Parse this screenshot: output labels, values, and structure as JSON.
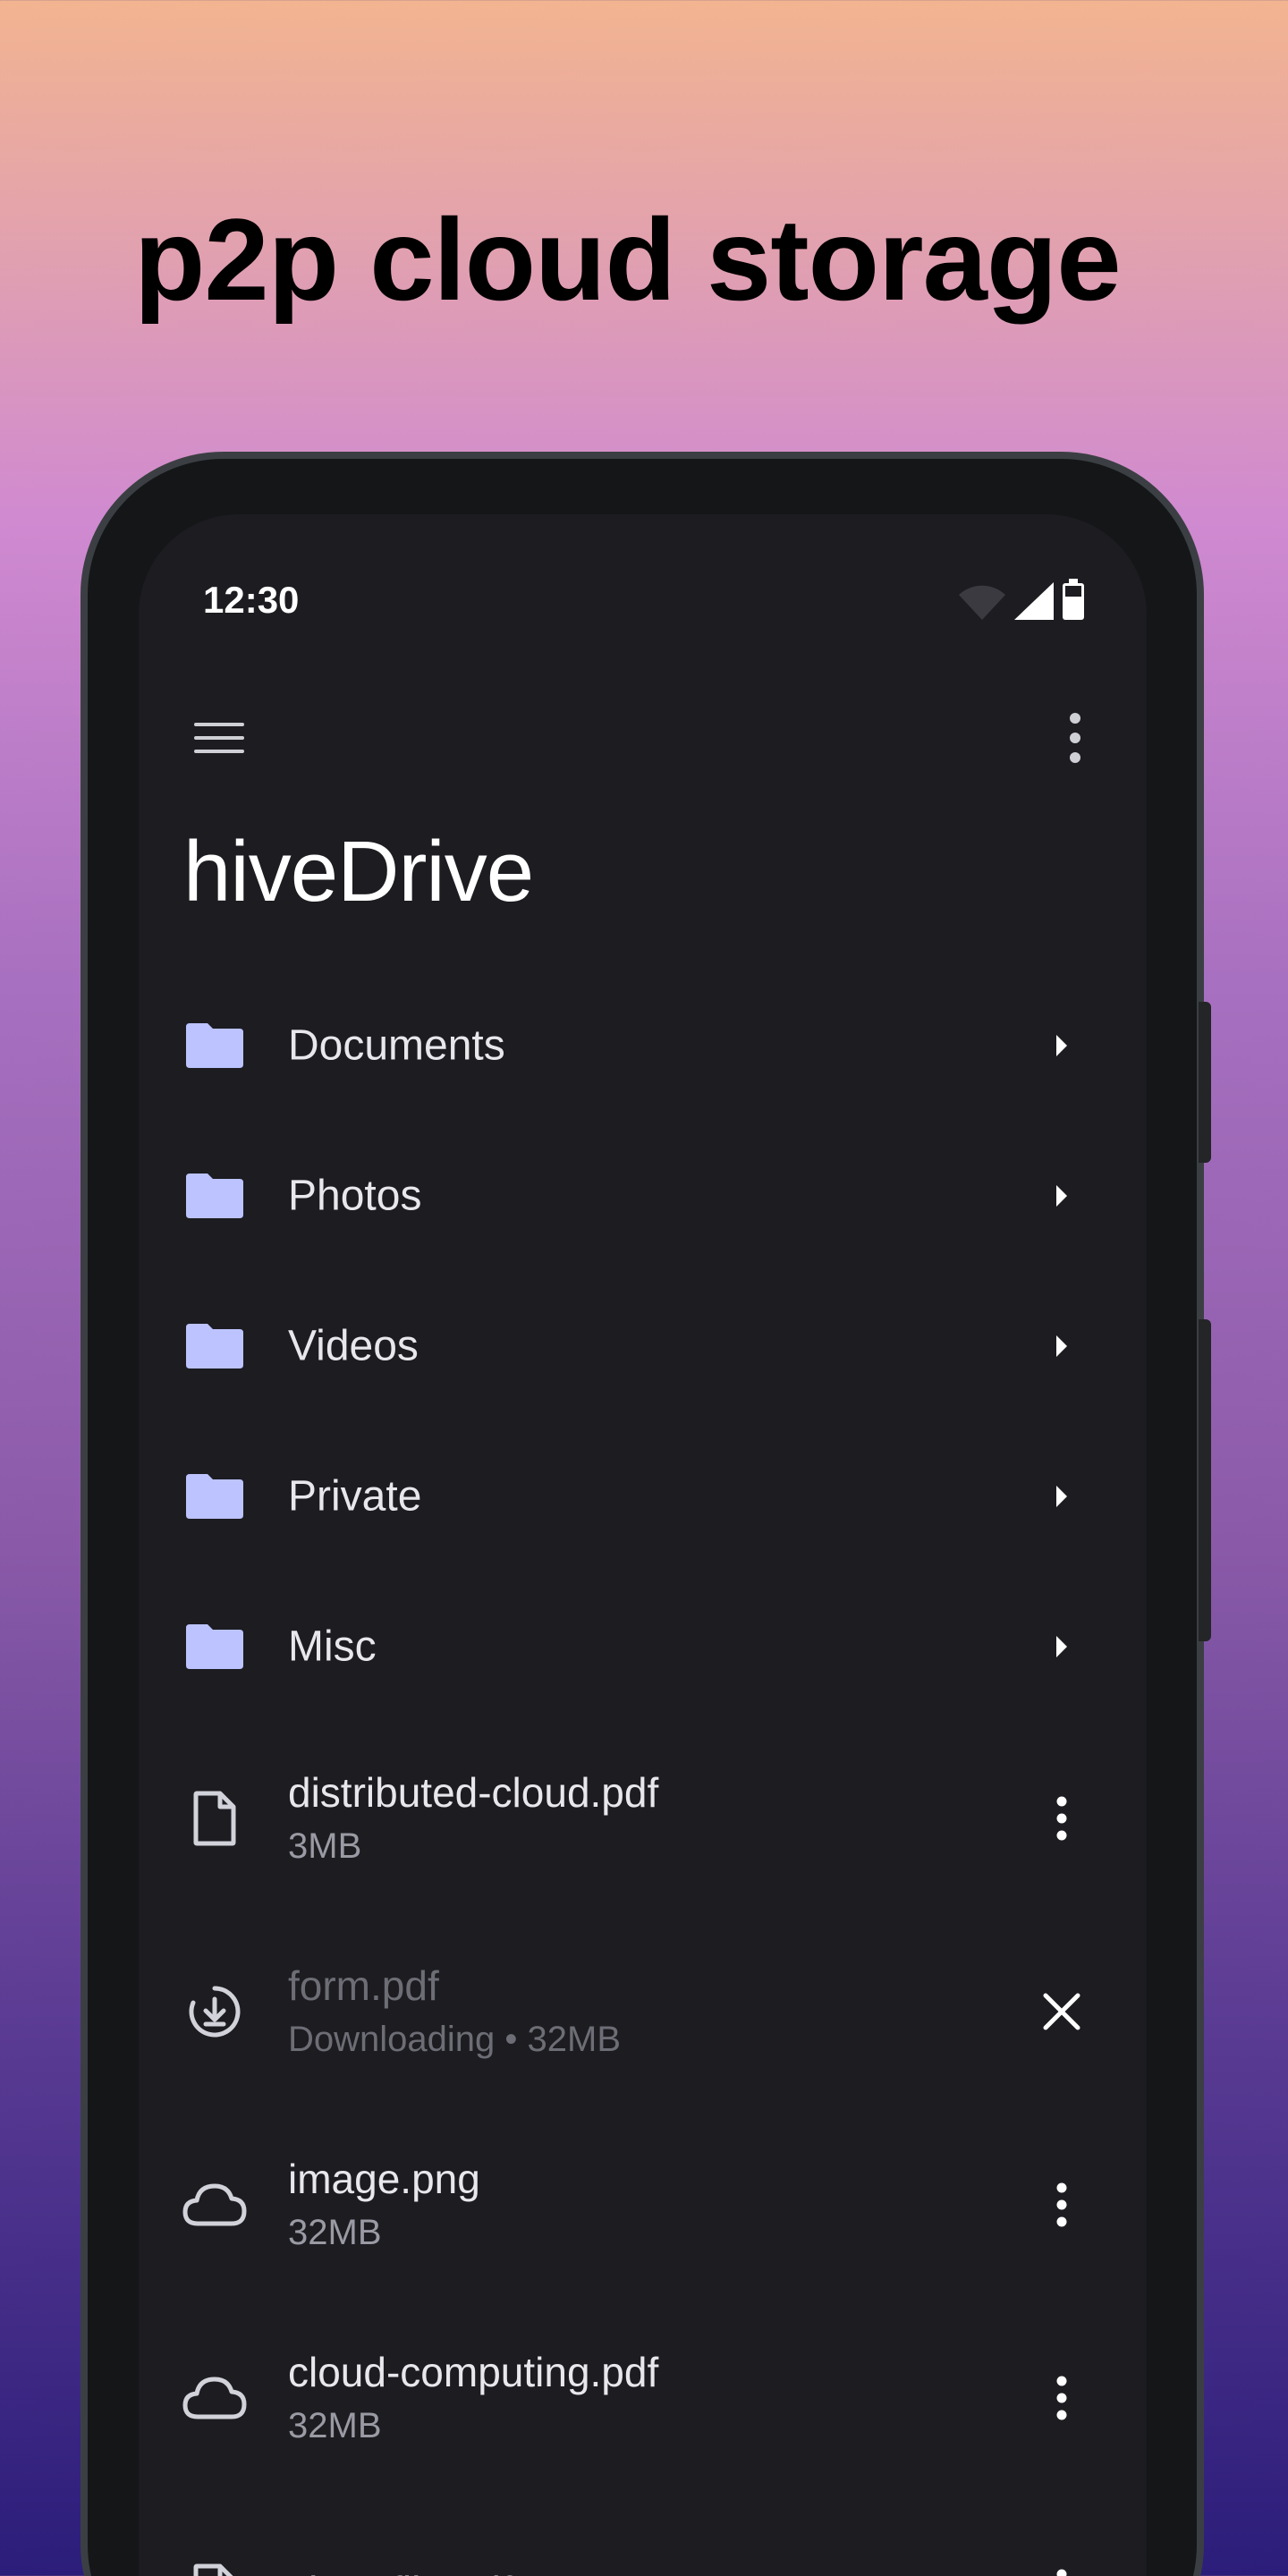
{
  "headline": "p2p cloud storage",
  "status_bar": {
    "time": "12:30"
  },
  "app_bar": {
    "title": "hiveDrive"
  },
  "folders": [
    {
      "name": "Documents"
    },
    {
      "name": "Photos"
    },
    {
      "name": "Videos"
    },
    {
      "name": "Private"
    },
    {
      "name": "Misc"
    }
  ],
  "files": [
    {
      "name": "distributed-cloud.pdf",
      "meta": "3MB",
      "status": "local"
    },
    {
      "name": "form.pdf",
      "meta": "Downloading • 32MB",
      "status": "downloading"
    },
    {
      "name": "image.png",
      "meta": "32MB",
      "status": "cloud"
    },
    {
      "name": "cloud-computing.pdf",
      "meta": "32MB",
      "status": "cloud"
    },
    {
      "name": "sharefile.pdf",
      "meta": "",
      "status": "local"
    }
  ],
  "colors": {
    "folder_icon": "#bcc3ff",
    "screen_bg": "#1c1c21",
    "text_primary": "#e8e8ec",
    "text_secondary": "#9a9aa4"
  }
}
